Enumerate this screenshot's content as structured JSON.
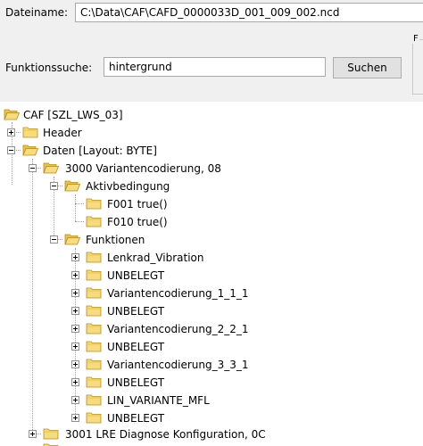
{
  "form": {
    "dateiname_label": "Dateiname:",
    "dateiname_value": "C:\\Data\\CAF\\CAFD_0000033D_001_009_002.ncd",
    "funktionssuche_label": "Funktionssuche:",
    "funktionssuche_value": "hintergrund",
    "suchen_button": "Suchen",
    "groupbox_letter": "F"
  },
  "tree": {
    "root": "CAF [SZL_LWS_03]",
    "header": "Header",
    "daten": "Daten [Layout: BYTE]",
    "vc3000": "3000 Variantencodierung, 08",
    "aktivbedingung": "Aktivbedingung",
    "f001": "F001 true()",
    "f010": "F010 true()",
    "funktionen": "Funktionen",
    "functions": [
      "Lenkrad_Vibration",
      "UNBELEGT",
      "Variantencodierung_1_1_1",
      "UNBELEGT",
      "Variantencodierung_2_2_1",
      "UNBELEGT",
      "Variantencodierung_3_3_1",
      "UNBELEGT",
      "LIN_VARIANTE_MFL",
      "UNBELEGT"
    ],
    "lre3001": "3001 LRE Diagnose Konfiguration, 0C"
  }
}
